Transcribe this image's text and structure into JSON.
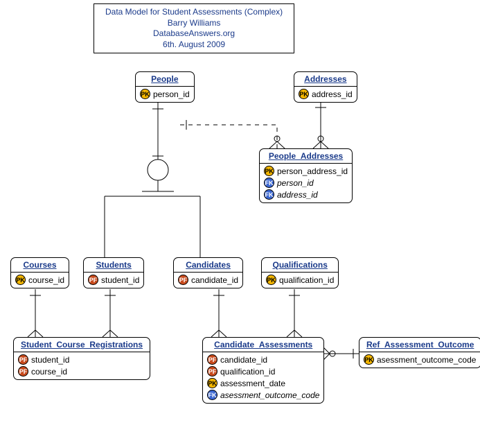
{
  "title": {
    "line1": "Data Model for Student Assessments (Complex)",
    "line2": "Barry Williams",
    "line3": "DatabaseAnswers.org",
    "line4": "6th. August 2009"
  },
  "entities": {
    "people": {
      "name": "People",
      "attrs": [
        {
          "k": "pk",
          "t": "person_id"
        }
      ]
    },
    "addresses": {
      "name": "Addresses",
      "attrs": [
        {
          "k": "pk",
          "t": "address_id"
        }
      ]
    },
    "people_addresses": {
      "name": "People_Addresses",
      "attrs": [
        {
          "k": "pk",
          "t": "person_address_id"
        },
        {
          "k": "fk",
          "t": "person_id",
          "i": true
        },
        {
          "k": "fk",
          "t": "address_id",
          "i": true
        }
      ]
    },
    "courses": {
      "name": "Courses",
      "attrs": [
        {
          "k": "pk",
          "t": "course_id"
        }
      ]
    },
    "students": {
      "name": "Students",
      "attrs": [
        {
          "k": "pf",
          "t": "student_id"
        }
      ]
    },
    "candidates": {
      "name": "Candidates",
      "attrs": [
        {
          "k": "pf",
          "t": "candidate_id"
        }
      ]
    },
    "qualifications": {
      "name": "Qualifications",
      "attrs": [
        {
          "k": "pk",
          "t": "qualification_id"
        }
      ]
    },
    "scr": {
      "name": "Student_Course_Registrations",
      "attrs": [
        {
          "k": "pf",
          "t": "student_id"
        },
        {
          "k": "pf",
          "t": "course_id"
        }
      ]
    },
    "ca": {
      "name": "Candidate_Assessments",
      "attrs": [
        {
          "k": "pf",
          "t": "candidate_id"
        },
        {
          "k": "pf",
          "t": "qualification_id"
        },
        {
          "k": "pk",
          "t": "assessment_date"
        },
        {
          "k": "fk",
          "t": "asessment_outcome_code",
          "i": true
        }
      ]
    },
    "rao": {
      "name": "Ref_Assessment_Outcome",
      "attrs": [
        {
          "k": "pk",
          "t": "asessment_outcome_code"
        }
      ]
    }
  },
  "badge": {
    "pk": "PK",
    "fk": "FK",
    "pf": "PF"
  }
}
